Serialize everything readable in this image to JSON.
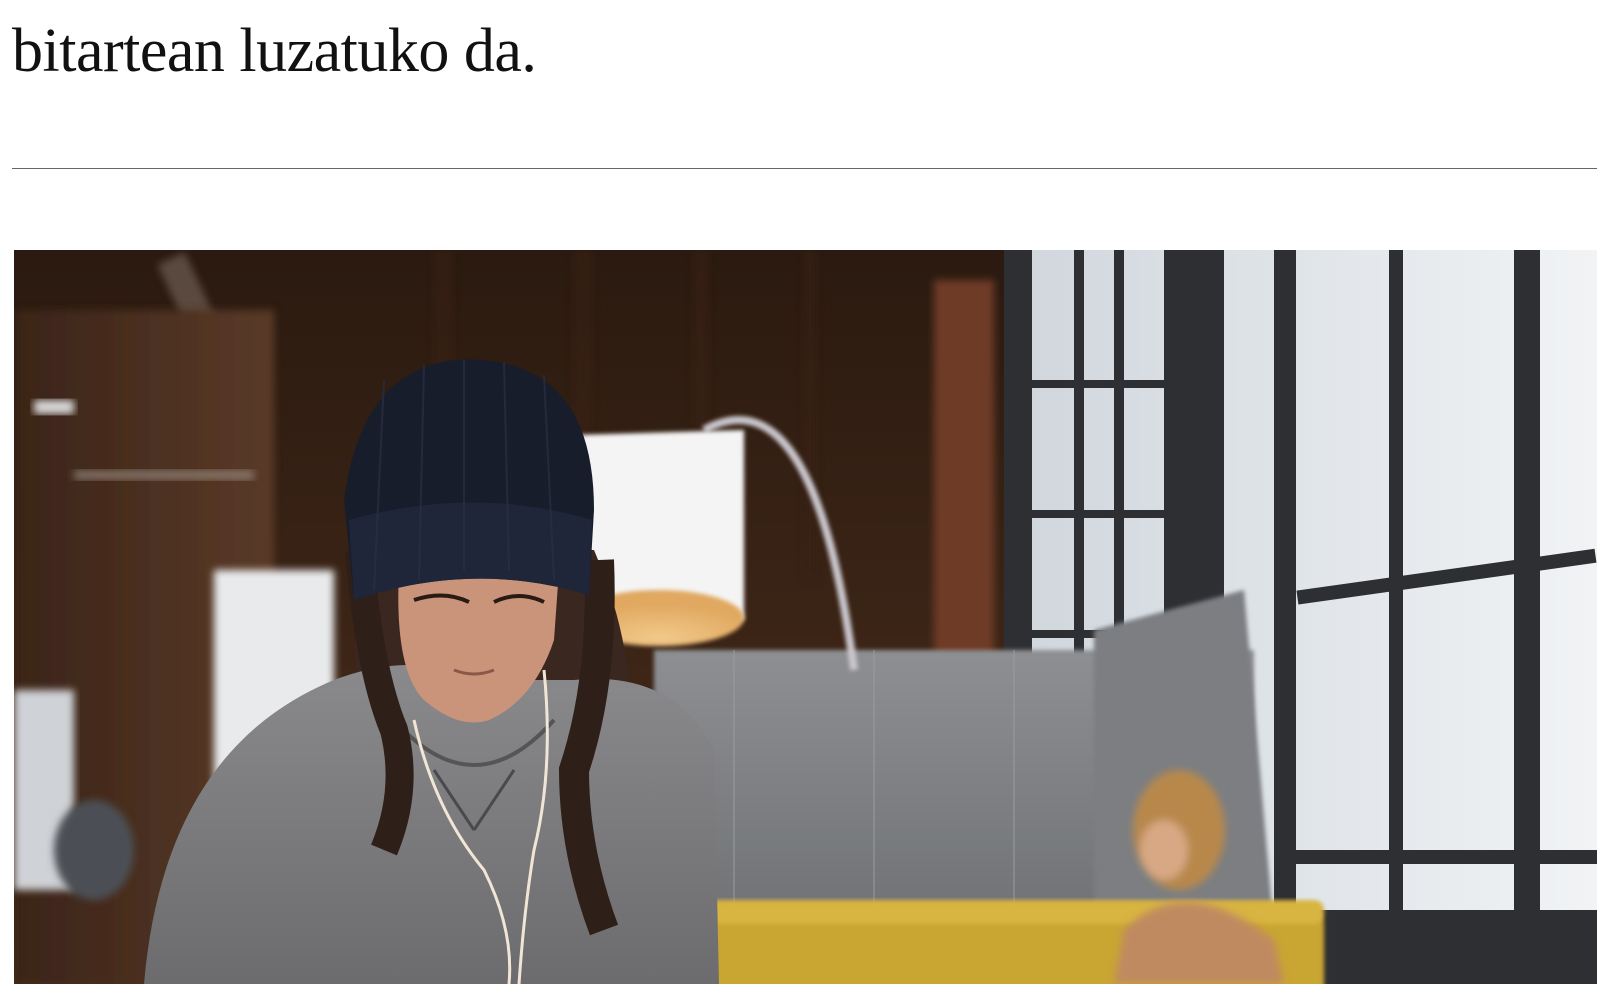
{
  "article": {
    "paragraph_tail": "bitartean luzatuko da."
  },
  "photo": {
    "subject": "woman-in-beanie-with-earphones-in-office-loft-photo"
  },
  "colors": {
    "text": "#111111",
    "divider": "#666666",
    "background": "#ffffff"
  }
}
